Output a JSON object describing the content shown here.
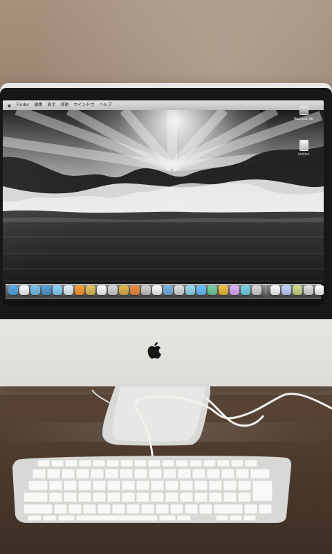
{
  "scene": {
    "description_visible_text": "",
    "wall_color": "#9c8672",
    "desk_color": "#4b392c",
    "imac_color": "#dedcd7",
    "bezel_color": "#171717"
  },
  "menu_bar": {
    "items": [
      "Finder",
      "編集",
      "表示",
      "移動",
      "ウインドウ",
      "ヘルプ"
    ]
  },
  "desktop_icons": [
    {
      "name": "hard-drive-icon",
      "label": "Macintosh HD"
    },
    {
      "name": "file-icon",
      "label": "Untitled"
    }
  ],
  "dock": {
    "icon_colors": [
      "#5aa7e8",
      "#ffffff",
      "#7cc4f0",
      "#54a0da",
      "#8ad6ff",
      "#e8f2ff",
      "#ff9f39",
      "#e7c25e",
      "#ffffff",
      "#d8d8d8",
      "#e3b74f",
      "#f08f3e",
      "#d0d0d0",
      "#ffffff",
      "#7db6e6",
      "#e0e0e0",
      "#9adcf0",
      "#68c4ff",
      "#7ad0a0",
      "#f5c043",
      "#e2b1ff",
      "#78d6e8",
      "#d8d8d8",
      "#ffffff",
      "#c6d7ff",
      "#cfdf8a",
      "#e0e0e0",
      "#ffffff",
      "#d2d2d2",
      "#a9a9a9"
    ]
  },
  "hardware": {
    "logo": "apple-logo"
  }
}
